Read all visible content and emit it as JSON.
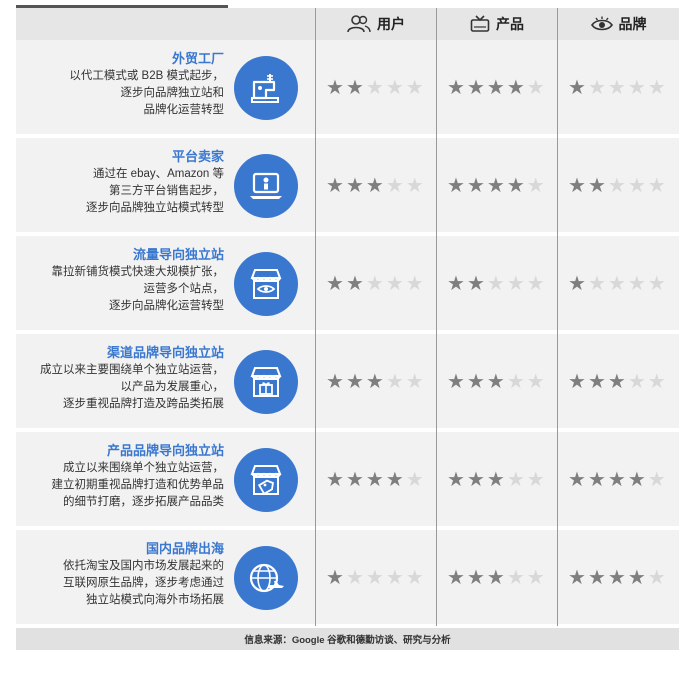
{
  "header": {
    "columns": [
      {
        "label": "用户",
        "icon": "users-icon"
      },
      {
        "label": "产品",
        "icon": "tv-icon"
      },
      {
        "label": "品牌",
        "icon": "eye-icon"
      }
    ]
  },
  "rows": [
    {
      "title": "外贸工厂",
      "lines": [
        "以代工模式或 B2B 模式起步，",
        "逐步向品牌独立站和",
        "品牌化运营转型"
      ],
      "icon": "sewing-machine-icon",
      "ratings": [
        2,
        4,
        1
      ]
    },
    {
      "title": "平台卖家",
      "lines": [
        "通过在 ebay、Amazon 等",
        "第三方平台销售起步，",
        "逐步向品牌独立站模式转型"
      ],
      "icon": "laptop-seller-icon",
      "ratings": [
        3,
        4,
        2
      ]
    },
    {
      "title": "流量导向独立站",
      "lines": [
        "靠拉新铺货模式快速大规模扩张，",
        "运营多个站点，",
        "逐步向品牌化运营转型"
      ],
      "icon": "store-eye-icon",
      "ratings": [
        2,
        2,
        1
      ]
    },
    {
      "title": "渠道品牌导向独立站",
      "lines": [
        "成立以来主要围绕单个独立站运营，",
        "以产品为发展重心，",
        "逐步重视品牌打造及跨品类拓展"
      ],
      "icon": "store-gift-icon",
      "ratings": [
        3,
        3,
        3
      ]
    },
    {
      "title": "产品品牌导向独立站",
      "lines": [
        "成立以来围绕单个独立站运营，",
        "建立初期重视品牌打造和优势单品",
        "的细节打磨，逐步拓展产品品类"
      ],
      "icon": "store-tag-icon",
      "ratings": [
        4,
        3,
        4
      ]
    },
    {
      "title": "国内品牌出海",
      "lines": [
        "依托淘宝及国内市场发展起来的",
        "互联网原生品牌，逐步考虑通过",
        "独立站模式向海外市场拓展"
      ],
      "icon": "globe-plane-icon",
      "ratings": [
        1,
        3,
        4
      ]
    }
  ],
  "max_stars": 5,
  "colors": {
    "accent": "#3a78d0",
    "star_on": "#7f7f7f",
    "star_off": "#d8d8d8"
  },
  "footer": {
    "source": "信息来源：Google 谷歌和德勤访谈、研究与分析"
  }
}
